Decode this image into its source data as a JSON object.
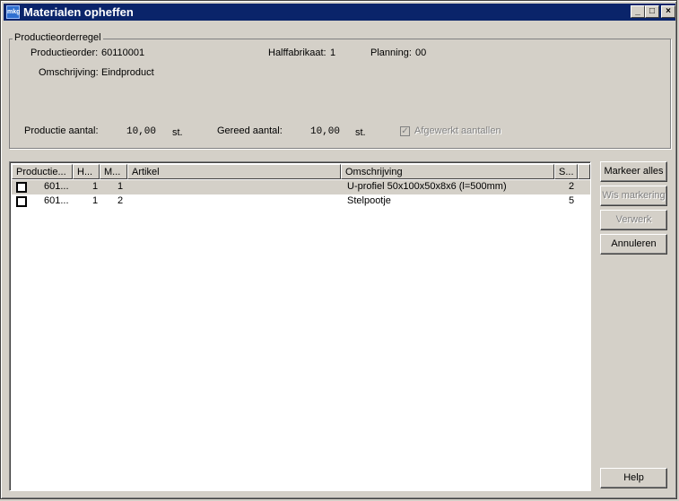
{
  "window": {
    "title": "Materialen opheffen",
    "icon": "mkg-app-icon",
    "icon_text": "mkg"
  },
  "group": {
    "label": "Productieorderregel",
    "productieorder_label": "Productieorder:",
    "productieorder_value": "60110001",
    "halffabrikaat_label": "Halffabrikaat:",
    "halffabrikaat_value": "1",
    "planning_label": "Planning:",
    "planning_value": "00",
    "omschrijving_label": "Omschrijving:",
    "omschrijving_value": "Eindproduct",
    "productie_aantal_label": "Productie aantal:",
    "productie_aantal_value": "10,00",
    "productie_aantal_unit": "st.",
    "gereed_aantal_label": "Gereed aantal:",
    "gereed_aantal_value": "10,00",
    "gereed_aantal_unit": "st.",
    "afgewerkt_label": "Afgewerkt aantallen",
    "afgewerkt_checked": true
  },
  "table": {
    "headers": [
      "Productie...",
      "H...",
      "M...",
      "Artikel",
      "Omschrijving",
      "S..."
    ],
    "rows": [
      {
        "checked": false,
        "productie": "601...",
        "h": "1",
        "m": "1",
        "artikel": "",
        "omschrijving": "U-profiel 50x100x50x8x6 (l=500mm)",
        "s": "2"
      },
      {
        "checked": false,
        "productie": "601...",
        "h": "1",
        "m": "2",
        "artikel": "",
        "omschrijving": "Stelpootje",
        "s": "5"
      }
    ]
  },
  "buttons": {
    "markeer_alles": "Markeer alles",
    "wis_markering": "Wis markering",
    "verwerk": "Verwerk",
    "annuleren": "Annuleren",
    "help": "Help"
  },
  "colors": {
    "titlebar": "#0a246a",
    "face": "#d4d0c8",
    "selected_row": "#d4d0c8"
  }
}
